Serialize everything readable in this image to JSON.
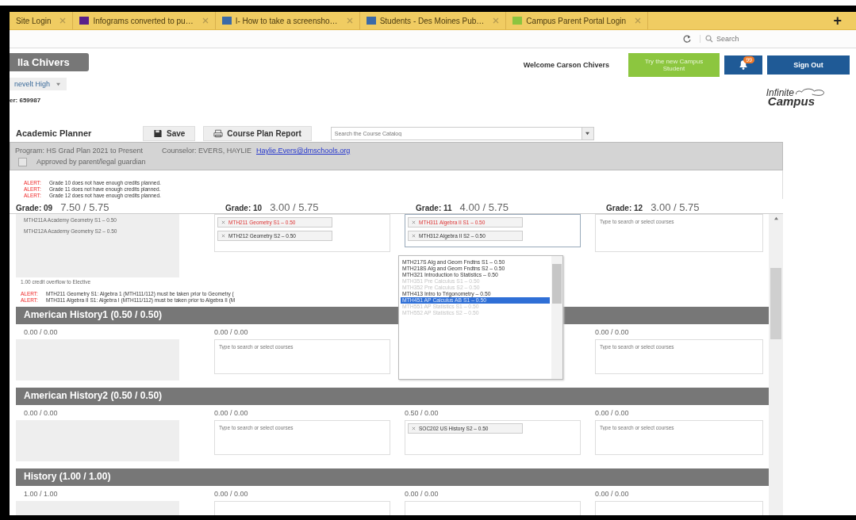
{
  "browser_tabs": [
    {
      "title": "Site Login",
      "kind": "plain",
      "selected": false
    },
    {
      "title": "Infograms converted to pu…",
      "kind": "purple",
      "selected": false
    },
    {
      "title": "I- How to take a screensho…",
      "kind": "blue",
      "selected": false
    },
    {
      "title": "Students - Des Moines Pub…",
      "kind": "blue",
      "selected": false
    },
    {
      "title": "Campus Parent Portal Login",
      "kind": "green",
      "selected": false
    }
  ],
  "new_tab": "+",
  "browser_search": {
    "placeholder": "Search"
  },
  "header": {
    "user_tab": "lla Chivers",
    "school": "nevelt High",
    "id_line": "er: 659987",
    "welcome": "Welcome Carson Chivers",
    "try_button": "Try the new Campus Student",
    "notification_count": "99",
    "sign_out": "Sign Out",
    "logo_top": "Infinite",
    "logo_bottom": "Campus"
  },
  "planner": {
    "title": "Academic Planner",
    "save": "Save",
    "report": "Course Plan Report",
    "catalog_search": {
      "placeholder": "Search the Course Catalog"
    },
    "program": "Program: HS Grad Plan 2021 to Present",
    "counselor": "Counselor: EVERS, HAYLIE",
    "counselor_email": "Haylie.Evers@dmschools.org",
    "approval": {
      "label": "Approved by parent/legal guardian",
      "checked": false
    },
    "alerts": [
      {
        "label": "ALERT:",
        "text": "Grade 10 does not have enough credits planned."
      },
      {
        "label": "ALERT:",
        "text": "Grade 11 does not have enough credits planned."
      },
      {
        "label": "ALERT:",
        "text": "Grade 12 does not have enough credits planned."
      }
    ],
    "grades": [
      {
        "label": "Grade: 09",
        "credits": "7.50 / 5.75"
      },
      {
        "label": "Grade: 10",
        "credits": "3.00 / 5.75"
      },
      {
        "label": "Grade: 11",
        "credits": "4.00 / 5.75"
      },
      {
        "label": "Grade: 12",
        "credits": "3.00 / 5.75"
      }
    ],
    "math_cells": [
      {
        "kind": "static",
        "courses": [
          "MTH211A Academy Geometry S1 – 0.50",
          "MTH212A Academy Geometry S2 – 0.50"
        ]
      },
      {
        "kind": "picker",
        "chips": [
          {
            "text": "MTH211 Geometry S1 – 0.50",
            "error": true
          },
          {
            "text": "MTH212 Geometry S2 – 0.50",
            "error": false
          }
        ]
      },
      {
        "kind": "picker",
        "focused": true,
        "chips": [
          {
            "text": "MTH311 Algebra II S1 – 0.50",
            "error": true
          },
          {
            "text": "MTH312 Algebra II S2 – 0.50",
            "error": false
          }
        ]
      },
      {
        "kind": "picker",
        "placeholder": "Type to search or select courses"
      }
    ],
    "overflow_note": "1.00 credit overflow to Elective",
    "section_alerts": [
      {
        "label": "ALERT:",
        "text": "MTH211 Geometry S1: Algebra 1 (MTH111/112) must be taken prior to Geometry ("
      },
      {
        "label": "ALERT:",
        "text": "MTH311 Algebra II S1: Algebra I (MTH111/112) must be taken prior to Algebra II (M"
      }
    ],
    "dropdown": [
      {
        "text": "MTH217S Alg and Geom Fndtns S1 – 0.50",
        "disabled": false,
        "selected": false
      },
      {
        "text": "MTH218S Alg and Geom Fndtns S2 – 0.50",
        "disabled": false,
        "selected": false
      },
      {
        "text": "MTH321 Introduction to Statistics – 0.50",
        "disabled": false,
        "selected": false
      },
      {
        "text": "MTH351 Pre Calculus S1 – 0.50",
        "disabled": true,
        "selected": false
      },
      {
        "text": "MTH352 Pre Calculus S2 – 0.50",
        "disabled": true,
        "selected": false
      },
      {
        "text": "MTH413 Intro to Trigonometry – 0.50",
        "disabled": false,
        "selected": false
      },
      {
        "text": "MTH451 AP Calculus AB S1 – 0.50",
        "disabled": false,
        "selected": true
      },
      {
        "text": "MTH551 AP Statistics S1 – 0.50",
        "disabled": true,
        "selected": false
      },
      {
        "text": "MTH552 AP Statistics S2 – 0.50",
        "disabled": true,
        "selected": false
      }
    ],
    "sections": [
      {
        "title": "American History1 (0.50 / 0.50)",
        "cells": [
          {
            "kind": "static",
            "credits": "0.00 / 0.00"
          },
          {
            "kind": "picker",
            "credits": "0.00 / 0.00",
            "placeholder": "Type to search or select courses"
          },
          {
            "kind": "covered"
          },
          {
            "kind": "picker",
            "credits": "0.00 / 0.00",
            "placeholder": "Type to search or select courses"
          }
        ]
      },
      {
        "title": "American History2 (0.50 / 0.50)",
        "cells": [
          {
            "kind": "static",
            "credits": "0.00 / 0.00"
          },
          {
            "kind": "picker",
            "credits": "0.00 / 0.00",
            "placeholder": "Type to search or select courses"
          },
          {
            "kind": "picker",
            "credits": "0.50 / 0.00",
            "chips": [
              {
                "text": "SOC202 US History S2 – 0.50",
                "error": false
              }
            ]
          },
          {
            "kind": "picker",
            "credits": "0.00 / 0.00",
            "placeholder": "Type to search or select courses"
          }
        ]
      },
      {
        "title": "History (1.00 / 1.00)",
        "cells": [
          {
            "kind": "static",
            "credits": "1.00 / 1.00"
          },
          {
            "kind": "picker",
            "credits": "0.00 / 0.00"
          },
          {
            "kind": "picker",
            "credits": "0.00 / 0.00"
          },
          {
            "kind": "picker",
            "credits": "0.00 / 0.00"
          }
        ]
      }
    ]
  }
}
